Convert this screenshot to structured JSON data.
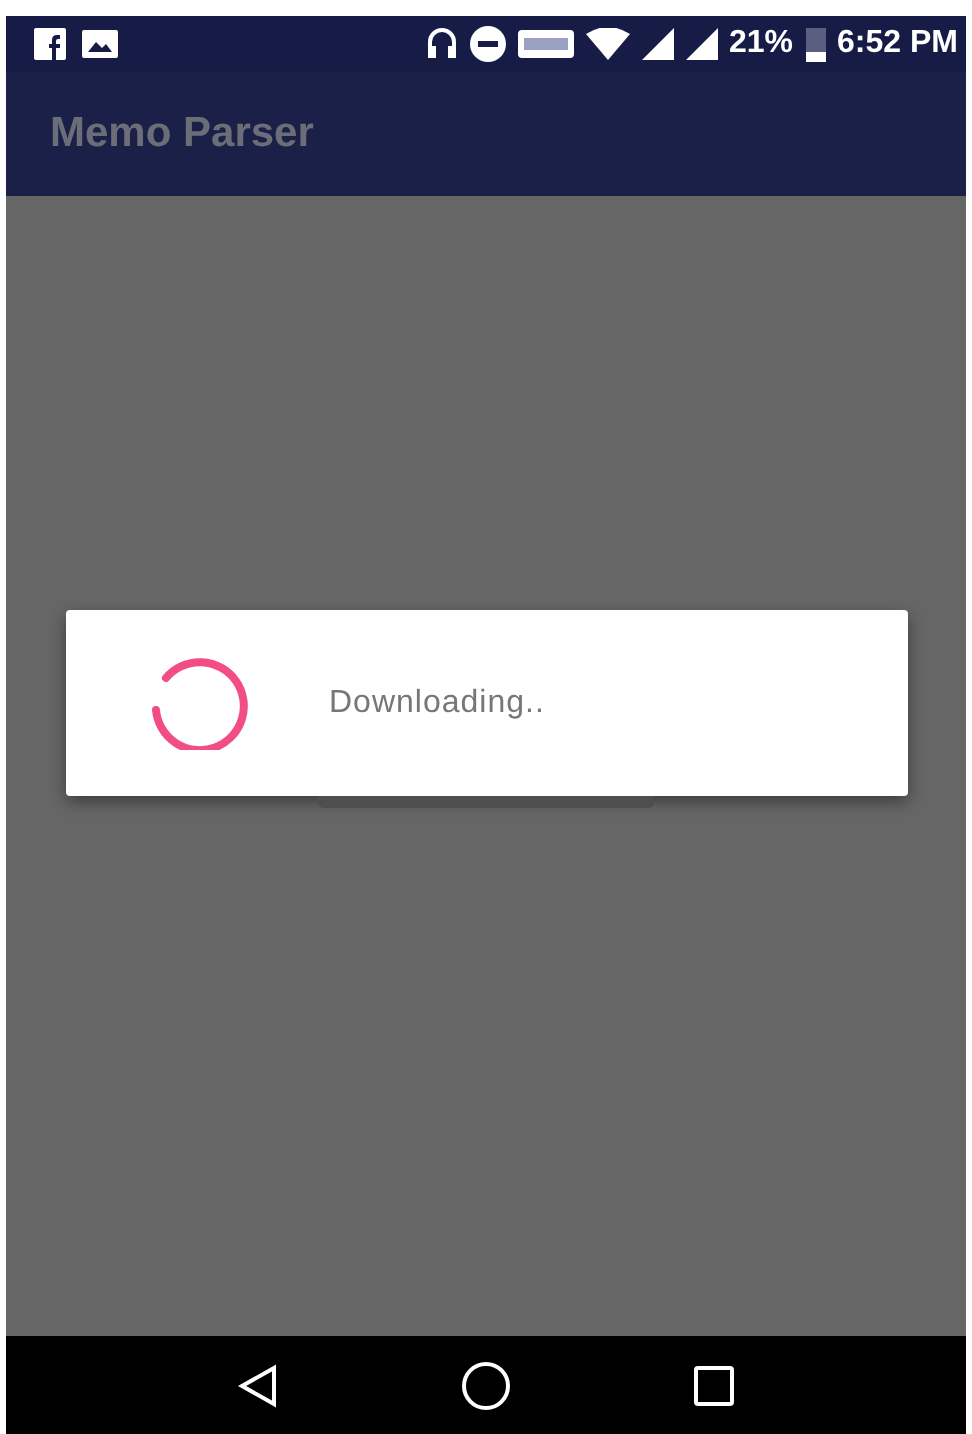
{
  "status_bar": {
    "battery": "21%",
    "time": "6:52 PM"
  },
  "app_bar": {
    "title": "Memo Parser"
  },
  "dialog": {
    "message": "Downloading.."
  }
}
